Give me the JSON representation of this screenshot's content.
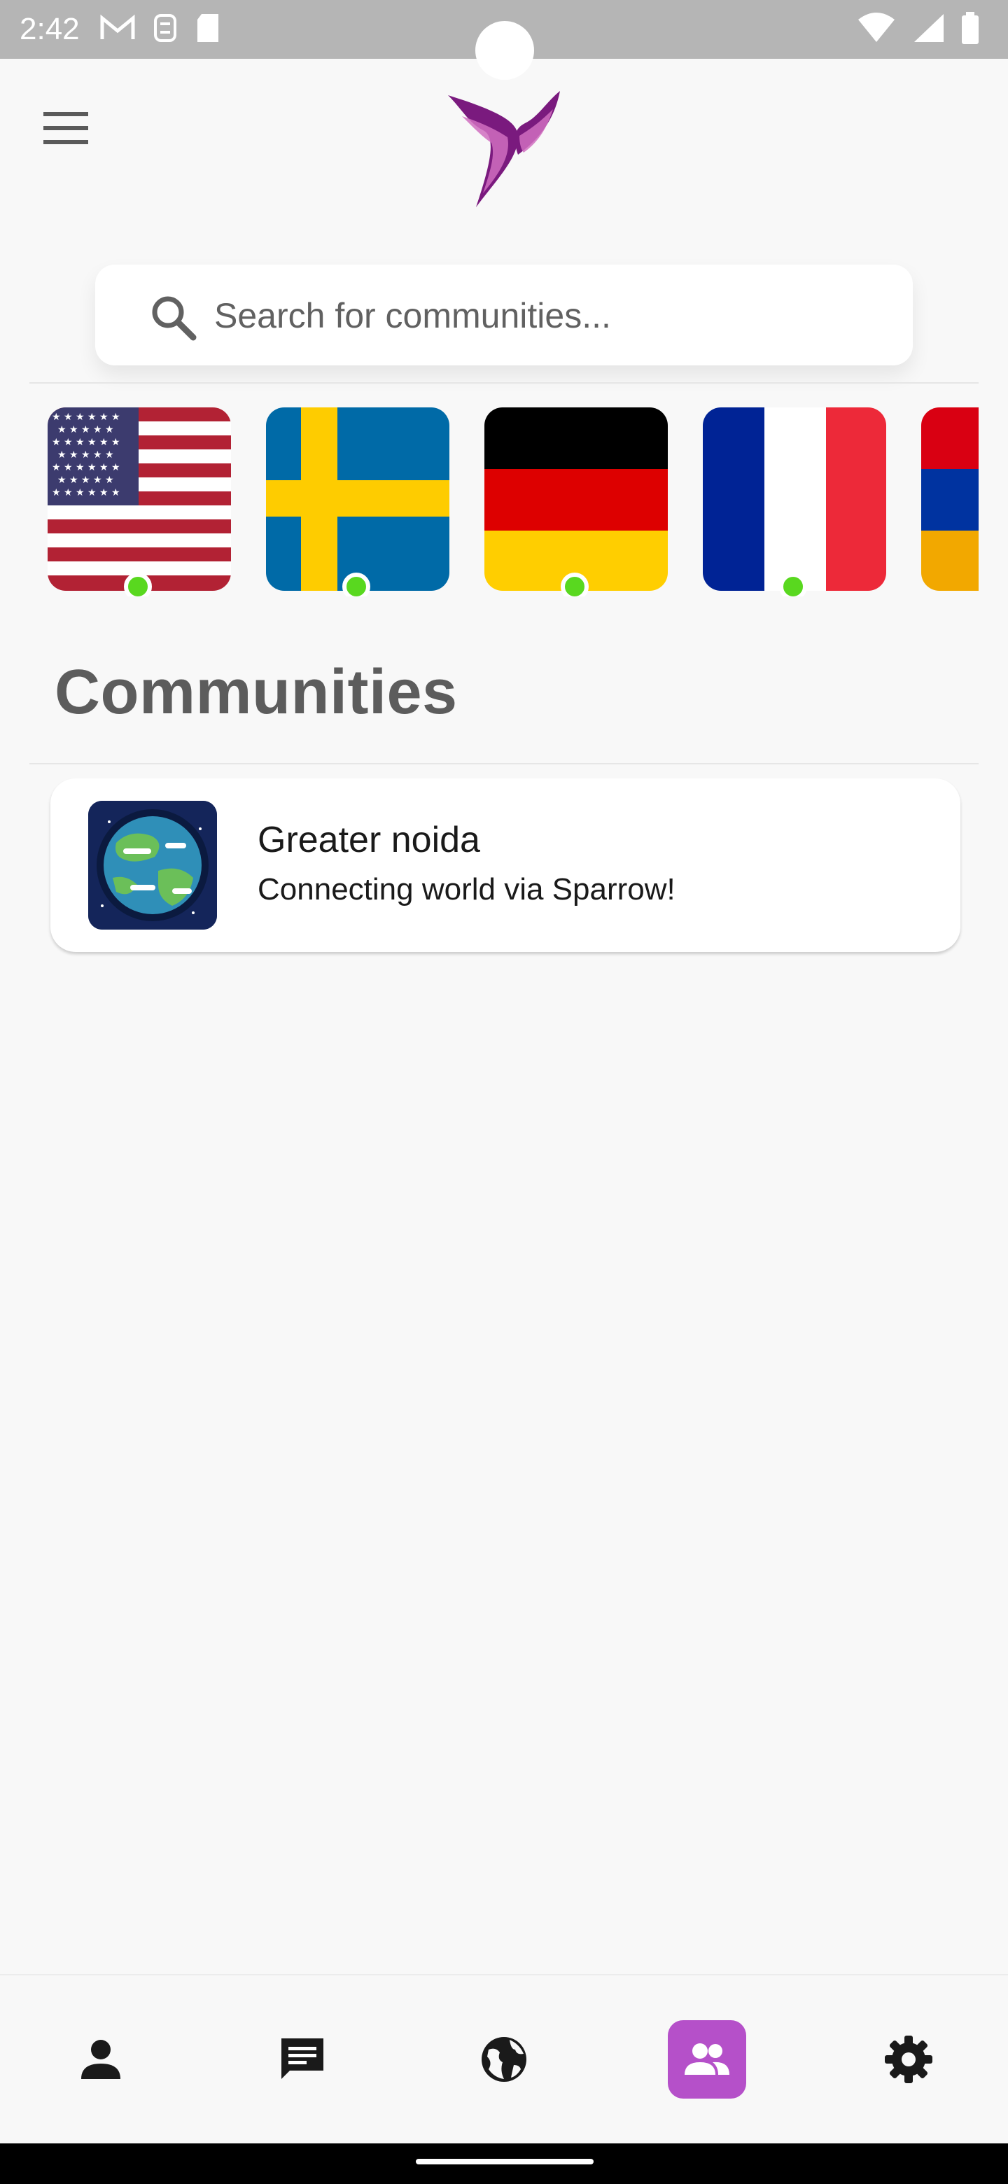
{
  "status_bar": {
    "time": "2:42",
    "left_icons": [
      "gmail-icon",
      "sim-toolkit-icon",
      "sd-card-icon"
    ],
    "right_icons": [
      "wifi-icon",
      "signal-icon",
      "battery-icon"
    ]
  },
  "header": {
    "menu_icon": "hamburger-menu-icon",
    "logo_icon": "sparrow-bird-logo"
  },
  "search": {
    "placeholder": "Search for communities...",
    "value": ""
  },
  "flags": [
    {
      "country": "United States",
      "icon": "us-flag",
      "online": true
    },
    {
      "country": "Sweden",
      "icon": "sweden-flag",
      "online": true
    },
    {
      "country": "Germany",
      "icon": "germany-flag",
      "online": true
    },
    {
      "country": "France",
      "icon": "france-flag",
      "online": true
    },
    {
      "country": "Armenia",
      "icon": "armenia-flag",
      "online": false
    }
  ],
  "section": {
    "title": "Communities"
  },
  "communities": [
    {
      "name": "Greater noida",
      "description": "Connecting world via Sparrow!",
      "avatar_icon": "earth-globe-icon"
    }
  ],
  "bottom_nav": {
    "items": [
      {
        "icon": "person-icon",
        "active": false
      },
      {
        "icon": "chat-icon",
        "active": false
      },
      {
        "icon": "globe-icon",
        "active": false
      },
      {
        "icon": "group-icon",
        "active": true
      },
      {
        "icon": "settings-icon",
        "active": false
      }
    ],
    "active_color": "#b550c9"
  },
  "colors": {
    "accent": "#b550c9",
    "online": "#59d81f",
    "logo_primary": "#7a1a7e",
    "logo_secondary": "#d06fc0"
  }
}
